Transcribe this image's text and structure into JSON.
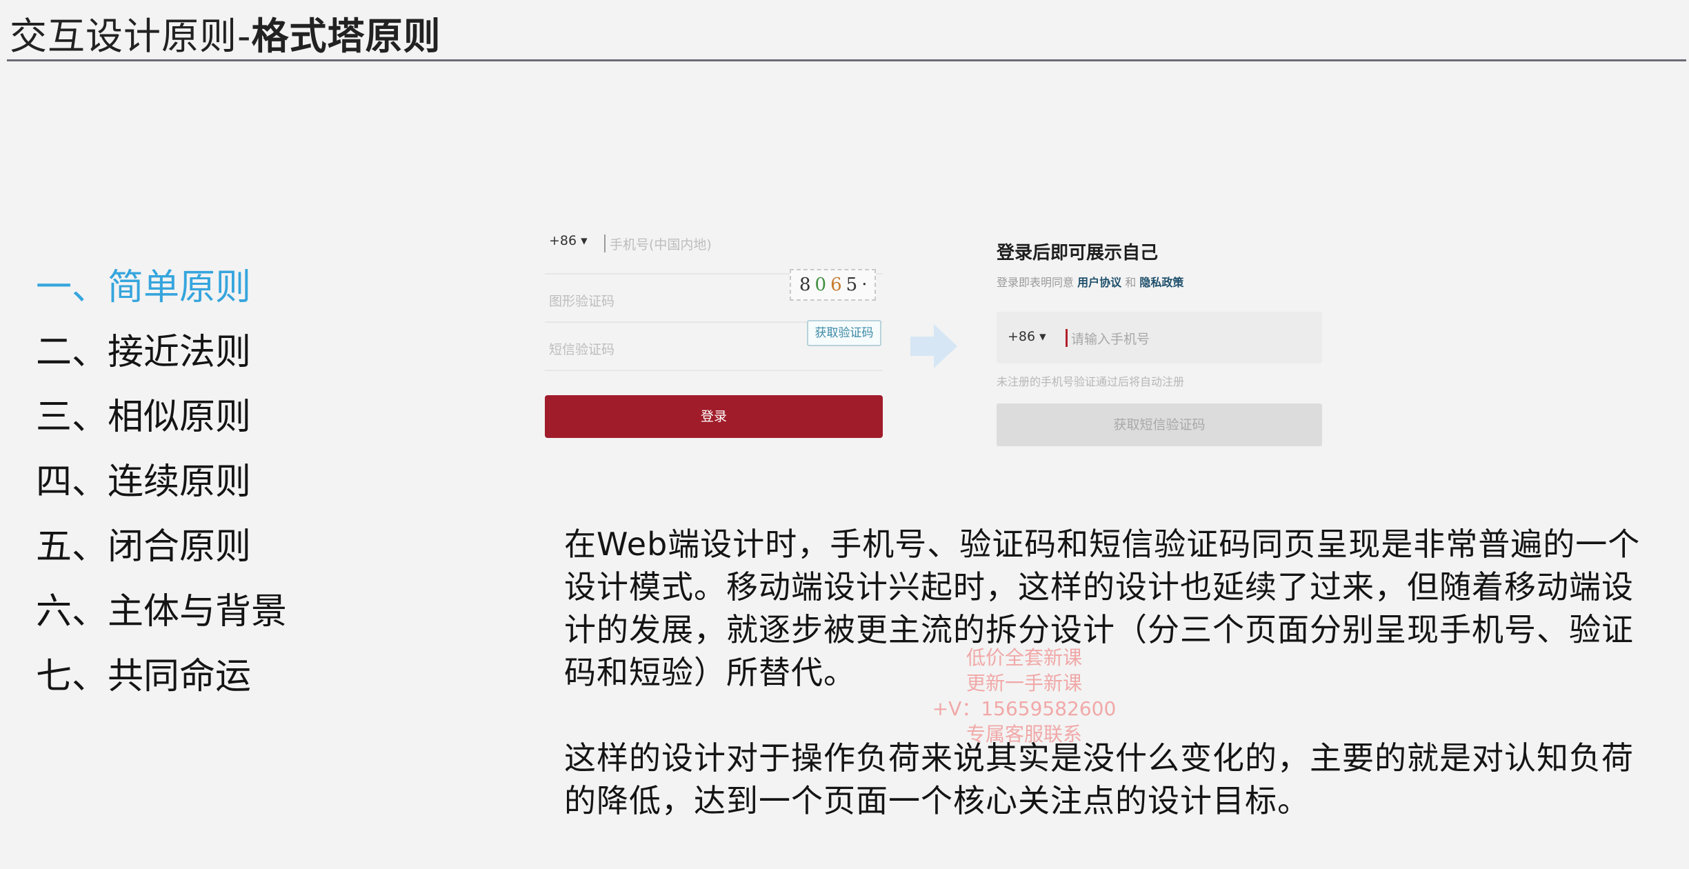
{
  "slide": {
    "title_prefix": "交互设计原则-",
    "title_main": "格式塔原则"
  },
  "outline": {
    "items": [
      {
        "label": "一、简单原则",
        "active": true
      },
      {
        "label": "二、接近法则",
        "active": false
      },
      {
        "label": "三、相似原则",
        "active": false
      },
      {
        "label": "四、连续原则",
        "active": false
      },
      {
        "label": "五、闭合原则",
        "active": false
      },
      {
        "label": "六、主体与背景",
        "active": false
      },
      {
        "label": "七、共同命运",
        "active": false
      }
    ],
    "active_color": "#35a5dd"
  },
  "web_login": {
    "country_code": "+86 ▾",
    "phone_placeholder": "手机号(中国内地)",
    "captcha_placeholder": "图形验证码",
    "captcha_chars": [
      "8",
      "0",
      "6",
      "5",
      "·"
    ],
    "sms_placeholder": "短信验证码",
    "sms_button": "获取验证码",
    "login_button": "登录",
    "brand_color": "#a01c2a"
  },
  "mobile_login": {
    "heading": "登录后即可展示自己",
    "agree_prefix": "登录即表明同意",
    "agreement_link": "用户协议",
    "and": "和",
    "privacy_link": "隐私政策",
    "country_code": "+86 ▾",
    "phone_placeholder": "请输入手机号",
    "note": "未注册的手机号验证通过后将自动注册",
    "sms_button": "获取短信验证码"
  },
  "arrow": {
    "icon": "arrow-right-icon",
    "color": "#d6e6f4"
  },
  "body": {
    "paragraph1": "在Web端设计时，手机号、验证码和短信验证码同页呈现是非常普遍的一个设计模式。移动端设计兴起时，这样的设计也延续了过来，但随着移动端设计的发展，就逐步被更主流的拆分设计（分三个页面分别呈现手机号、验证码和短验）所替代。",
    "paragraph2": "这样的设计对于操作负荷来说其实是没什么变化的，主要的就是对认知负荷的降低，达到一个页面一个核心关注点的设计目标。"
  },
  "watermark": {
    "line1": "低价全套新课",
    "line2": "更新一手新课",
    "line3": "+V：15659582600",
    "line4": "专属客服联系"
  }
}
